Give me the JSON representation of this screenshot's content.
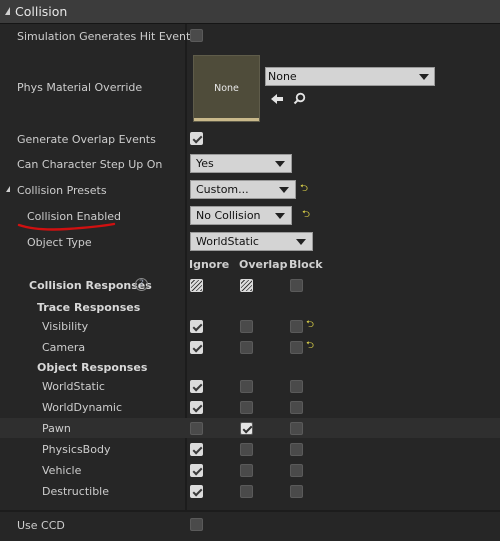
{
  "header": {
    "title": "Collision"
  },
  "labels": {
    "sim_hit": "Simulation Generates Hit Events",
    "phys_mat": "Phys Material Override",
    "gen_overlap": "Generate Overlap Events",
    "step_up": "Can Character Step Up On",
    "presets": "Collision Presets",
    "coll_enabled": "Collision Enabled",
    "obj_type": "Object Type",
    "coll_responses": "Collision Responses",
    "trace_responses": "Trace Responses",
    "object_responses": "Object Responses",
    "use_ccd": "Use CCD"
  },
  "phys_material": {
    "thumb_text": "None",
    "combo_value": "None"
  },
  "combos": {
    "step_up": "Yes",
    "presets": "Custom...",
    "coll_enabled": "No Collision",
    "obj_type": "WorldStatic"
  },
  "columns": {
    "ignore": "Ignore",
    "overlap": "Overlap",
    "block": "Block"
  },
  "trace_rows": [
    {
      "name": "Visibility",
      "ignore": true,
      "overlap": false,
      "block": false
    },
    {
      "name": "Camera",
      "ignore": true,
      "overlap": false,
      "block": false
    }
  ],
  "object_rows": [
    {
      "name": "WorldStatic",
      "ignore": true,
      "overlap": false,
      "block": false
    },
    {
      "name": "WorldDynamic",
      "ignore": true,
      "overlap": false,
      "block": false
    },
    {
      "name": "Pawn",
      "ignore": false,
      "overlap": true,
      "block": false
    },
    {
      "name": "PhysicsBody",
      "ignore": true,
      "overlap": false,
      "block": false
    },
    {
      "name": "Vehicle",
      "ignore": true,
      "overlap": false,
      "block": false
    },
    {
      "name": "Destructible",
      "ignore": true,
      "overlap": false,
      "block": false
    }
  ],
  "checks": {
    "sim_hit": false,
    "gen_overlap": true,
    "use_ccd": false
  },
  "colors": {
    "annotation_underline": "#d01010",
    "reset_arrow": "#e3d84a"
  }
}
